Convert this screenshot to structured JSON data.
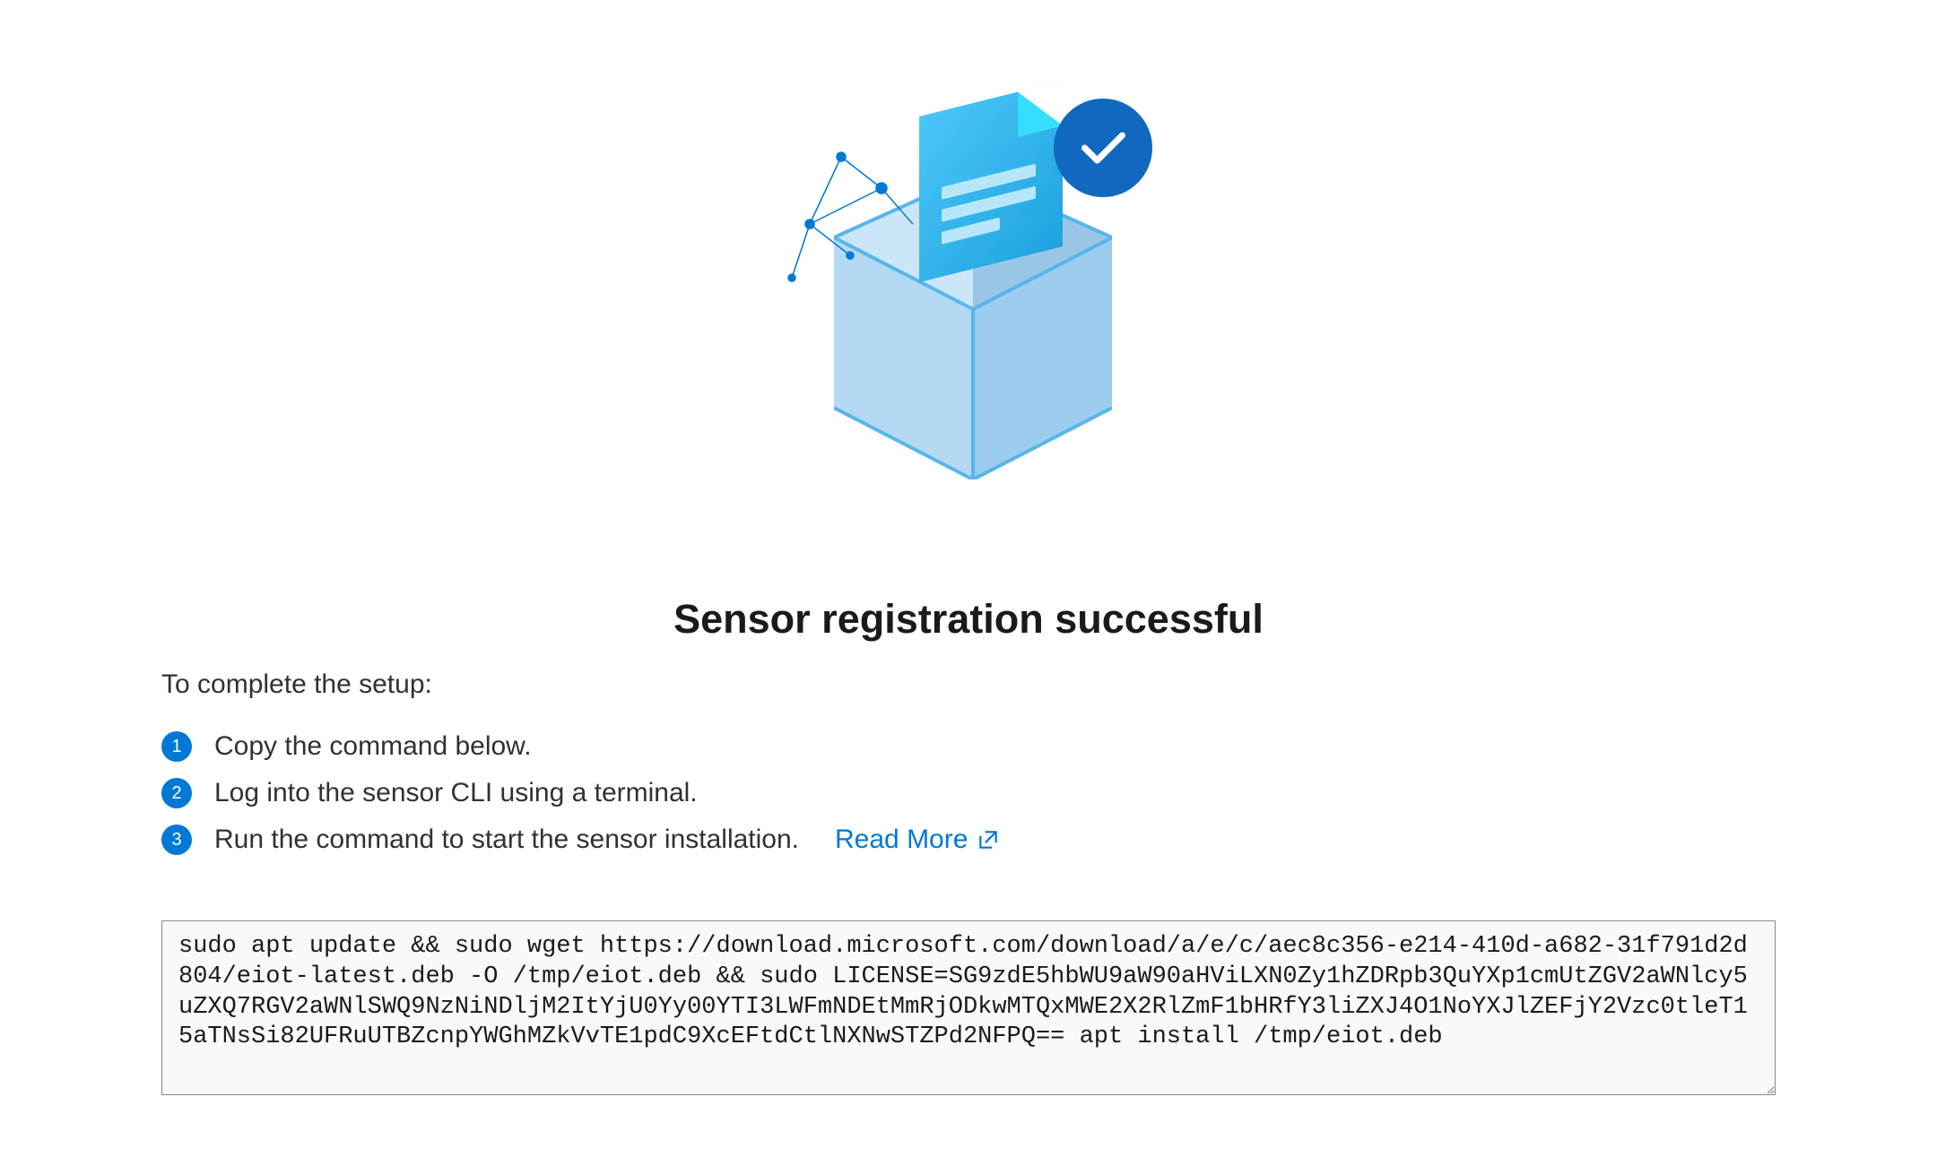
{
  "title": "Sensor registration successful",
  "intro": "To complete the setup:",
  "steps": [
    {
      "num": "1",
      "text": "Copy the command below."
    },
    {
      "num": "2",
      "text": "Log into the sensor CLI using a terminal."
    },
    {
      "num": "3",
      "text": "Run the command to start the sensor installation."
    }
  ],
  "read_more": "Read More",
  "command": "sudo apt update && sudo wget https://download.microsoft.com/download/a/e/c/aec8c356-e214-410d-a682-31f791d2d804/eiot-latest.deb -O /tmp/eiot.deb && sudo LICENSE=SG9zdE5hbWU9aW90aHViLXN0Zy1hZDRpb3QuYXp1cmUtZGV2aWNlcy5uZXQ7RGV2aWNlSWQ9NzNiNDljM2ItYjU0Yy00YTI3LWFmNDEtMmRjODkwMTQxMWE2X2RlZmF1bHRfY3liZXJ4O1NoYXJlZEFjY2Vzc0tleT15aTNsSi82UFRuUTBZcnpYWGhMZkVvTE1pdC9XcEFtdCtlNXNwSTZPd2NFPQ== apt install /tmp/eiot.deb",
  "icons": {
    "checkmark": "checkmark-icon",
    "external": "external-link-icon",
    "box": "sensor-box-illustration"
  },
  "colors": {
    "primary": "#0078d4",
    "badge": "#1168bf"
  }
}
